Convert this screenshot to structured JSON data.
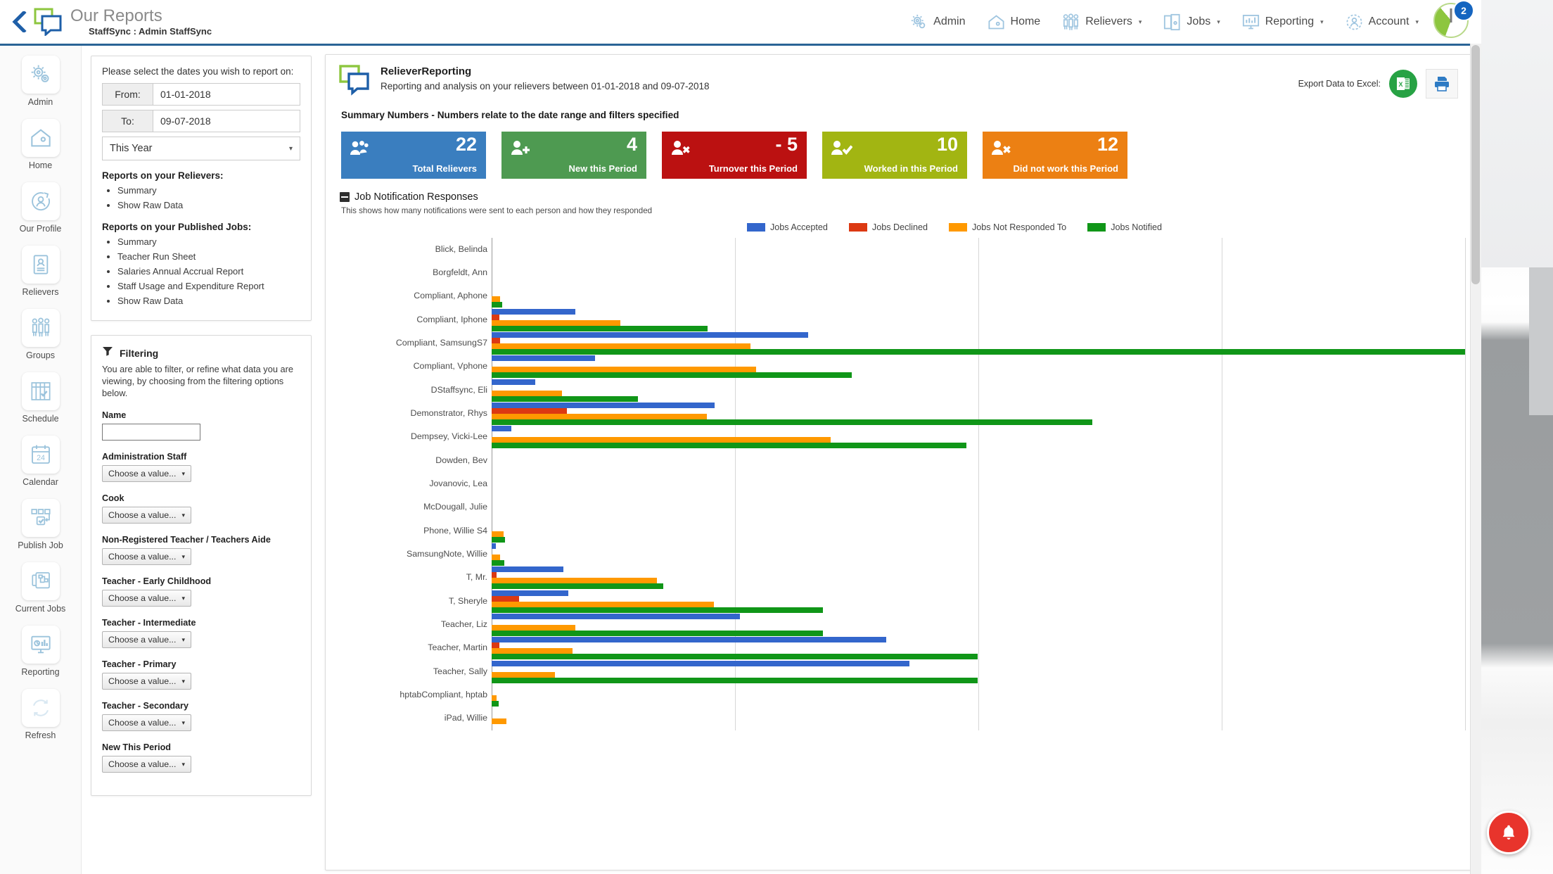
{
  "window": {
    "title": "Our Reports",
    "subtitle": "StaffSync : Admin StaffSync",
    "back_icon": "back-chevron-icon"
  },
  "topnav": {
    "items": [
      {
        "label": "Admin",
        "icon": "gear-icon",
        "caret": ""
      },
      {
        "label": "Home",
        "icon": "home-icon",
        "caret": ""
      },
      {
        "label": "Relievers",
        "icon": "people-icon",
        "caret": "▾"
      },
      {
        "label": "Jobs",
        "icon": "documents-icon",
        "caret": "▾"
      },
      {
        "label": "Reporting",
        "icon": "monitor-chart-icon",
        "caret": "▾"
      },
      {
        "label": "Account",
        "icon": "user-gear-icon",
        "caret": "▾"
      }
    ],
    "avatar_badge": "2"
  },
  "rail": {
    "items": [
      {
        "label": "Admin",
        "icon": "gear-icon"
      },
      {
        "label": "Home",
        "icon": "home-icon"
      },
      {
        "label": "Our Profile",
        "icon": "profile-circle-icon"
      },
      {
        "label": "Relievers",
        "icon": "id-card-icon"
      },
      {
        "label": "Groups",
        "icon": "people-group-icon"
      },
      {
        "label": "Schedule",
        "icon": "schedule-grid-icon"
      },
      {
        "label": "Calendar",
        "icon": "calendar-icon",
        "day": "24"
      },
      {
        "label": "Publish Job",
        "icon": "steps-check-icon"
      },
      {
        "label": "Current Jobs",
        "icon": "jobs-board-icon"
      },
      {
        "label": "Reporting",
        "icon": "monitor-chart-icon"
      },
      {
        "label": "Refresh",
        "icon": "refresh-arrows-icon"
      }
    ]
  },
  "dates_panel": {
    "lead": "Please select the dates you wish to report on:",
    "from_label": "From:",
    "from_value": "01-01-2018",
    "to_label": "To:",
    "to_value": "09-07-2018",
    "range_select": "This Year",
    "range_caret": "▾",
    "relievers_heading": "Reports on your Relievers:",
    "relievers_links": [
      "Summary",
      "Show Raw Data"
    ],
    "jobs_heading": "Reports on your Published Jobs:",
    "jobs_links": [
      "Summary",
      "Teacher Run Sheet",
      "Salaries Annual Accrual Report",
      "Staff Usage and Expenditure Report",
      "Show Raw Data"
    ]
  },
  "filter_panel": {
    "title": "Filtering",
    "icon": "funnel-icon",
    "description": "You are able to filter, or refine what data you are viewing, by choosing from the filtering options below.",
    "name_label": "Name",
    "name_value": "",
    "name_placeholder": "",
    "choose_placeholder": "Choose a value...",
    "caret": "▾",
    "fields": [
      "Administration Staff",
      "Cook",
      "Non-Registered Teacher / Teachers Aide",
      "Teacher - Early Childhood",
      "Teacher - Intermediate",
      "Teacher - Primary",
      "Teacher - Secondary",
      "New This Period"
    ]
  },
  "report": {
    "icon": "staffsync-logo-icon",
    "title": "RelieverReporting",
    "subtitle": "Reporting and analysis on your relievers between 01-01-2018 and 09-07-2018",
    "export_label": "Export Data to Excel:",
    "excel_icon": "excel-icon",
    "print_icon": "printer-icon",
    "summary_title": "Summary Numbers - Numbers relate to the date range and filters specified",
    "cards": [
      {
        "value": "22",
        "label": "Total Relievers",
        "color": "#3a7ebf",
        "icon": "users-icon"
      },
      {
        "value": "4",
        "label": "New this Period",
        "color": "#4e9a51",
        "icon": "user-plus-icon"
      },
      {
        "value": "- 5",
        "label": "Turnover this Period",
        "color": "#bb1111",
        "icon": "user-x-icon"
      },
      {
        "value": "10",
        "label": "Worked in this Period",
        "color": "#a2b512",
        "icon": "user-check-icon"
      },
      {
        "value": "12",
        "label": "Did not work this Period",
        "color": "#ec8013",
        "icon": "user-cross-icon"
      }
    ]
  },
  "chart_section": {
    "collapse_icon": "collapse-minus-icon",
    "title": "Job Notification Responses",
    "description": "This shows how many notifications were sent to each person and how they responded"
  },
  "chart_data": {
    "type": "bar",
    "orientation": "horizontal",
    "title": "Job Notification Responses",
    "xlabel": "",
    "ylabel": "",
    "xlim": [
      0,
      100
    ],
    "grid": true,
    "gridline_values": [
      25,
      50,
      75,
      100
    ],
    "legend_position": "top-center",
    "colors": {
      "Jobs Accepted": "#3366cc",
      "Jobs Declined": "#dc3912",
      "Jobs Not Responded To": "#ff9900",
      "Jobs Notified": "#109618"
    },
    "legend": [
      "Jobs Accepted",
      "Jobs Declined",
      "Jobs Not Responded To",
      "Jobs Notified"
    ],
    "categories": [
      "Blick, Belinda",
      "Borgfeldt, Ann",
      "Compliant, Aphone",
      "Compliant, Iphone",
      "Compliant, SamsungS7",
      "Compliant, Vphone",
      "DStaffsync, Eli",
      "Demonstrator, Rhys",
      "Dempsey, Vicki-Lee",
      "Dowden, Bev",
      "Jovanovic, Lea",
      "McDougall, Julie",
      "Phone, Willie S4",
      "SamsungNote, Willie",
      "T, Mr.",
      "T, Sheryle",
      "Teacher, Liz",
      "Teacher, Martin",
      "Teacher, Sally",
      "hptabCompliant, hptab",
      "iPad, Willie"
    ],
    "series": [
      {
        "name": "Jobs Accepted",
        "values": [
          0,
          0,
          0,
          8.6,
          32.5,
          10.6,
          4.5,
          22.9,
          2,
          0,
          0,
          0,
          0,
          0.4,
          7.4,
          7.9,
          25.5,
          40.5,
          42.9,
          0,
          0
        ]
      },
      {
        "name": "Jobs Declined",
        "values": [
          0,
          0,
          0,
          0.8,
          0.9,
          0,
          0,
          7.7,
          0,
          0,
          0,
          0,
          0,
          0,
          0.5,
          2.8,
          0,
          0.8,
          0,
          0,
          0
        ]
      },
      {
        "name": "Jobs Not Responded To",
        "values": [
          0,
          0,
          0.9,
          13.2,
          26.6,
          27.2,
          7.2,
          22.1,
          34.8,
          0,
          0,
          0,
          1.2,
          0.9,
          17,
          22.8,
          8.6,
          8.3,
          6.5,
          0.5,
          1.5
        ]
      },
      {
        "name": "Jobs Notified",
        "values": [
          0,
          0,
          1.1,
          22.2,
          100,
          37,
          15,
          61.7,
          48.8,
          0,
          0,
          0,
          1.4,
          1.3,
          17.6,
          34,
          34,
          49.9,
          49.9,
          0.7,
          0
        ]
      }
    ]
  }
}
